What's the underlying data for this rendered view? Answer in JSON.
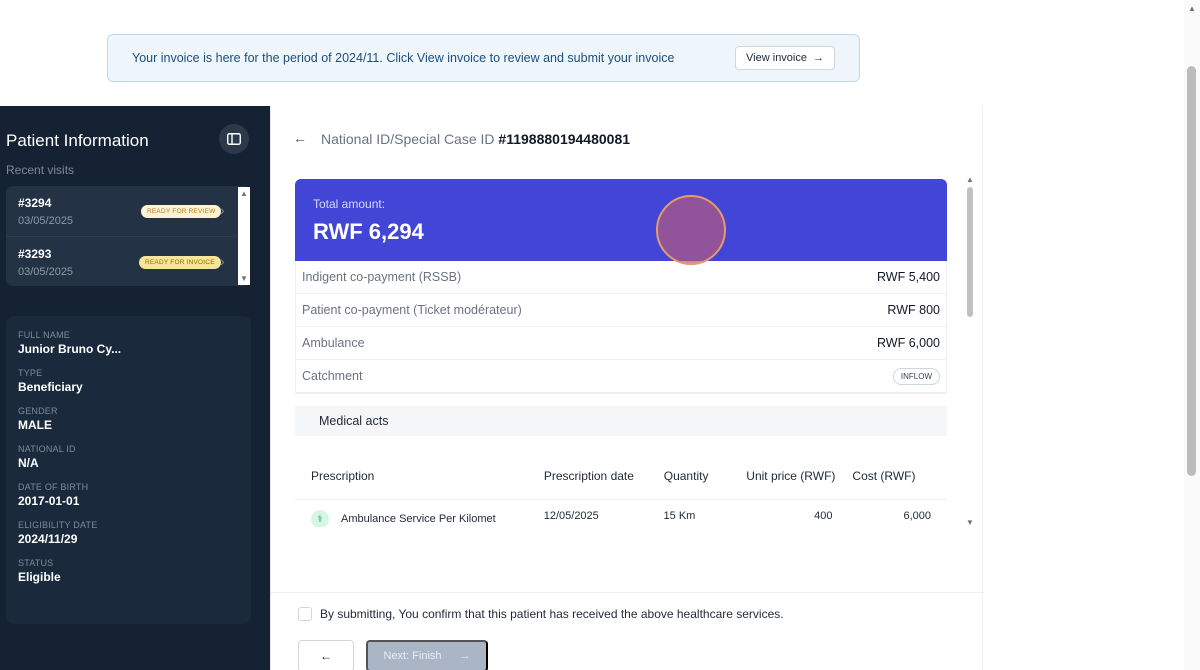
{
  "banner": {
    "message": "Your invoice is here for the period of 2024/11. Click View invoice to review and submit your invoice",
    "button_label": "View invoice",
    "button_icon": "→"
  },
  "sidebar": {
    "title": "Patient Information",
    "collapse_icon": "panel-icon",
    "recent_label": "Recent visits",
    "visits": [
      {
        "id": "#3294",
        "date": "03/05/2025",
        "badge": "READY FOR REVIEW"
      },
      {
        "id": "#3293",
        "date": "03/05/2025",
        "badge": "READY FOR INVOICE"
      }
    ],
    "info": [
      {
        "label": "FULL NAME",
        "value": "Junior Bruno Cy..."
      },
      {
        "label": "TYPE",
        "value": "Beneficiary"
      },
      {
        "label": "GENDER",
        "value": "MALE"
      },
      {
        "label": "NATIONAL ID",
        "value": "N/A"
      },
      {
        "label": "DATE OF BIRTH",
        "value": "2017-01-01"
      },
      {
        "label": "ELIGIBILITY DATE",
        "value": "2024/11/29"
      },
      {
        "label": "STATUS",
        "value": "Eligible"
      }
    ]
  },
  "main": {
    "back_icon": "←",
    "case_label": "National ID/Special Case ID",
    "case_id": "#1198880194480081",
    "total_label": "Total amount:",
    "total_amount": "RWF 6,294",
    "rows": [
      {
        "label": "Indigent co-payment (RSSB)",
        "value": "RWF 5,400"
      },
      {
        "label": "Patient co-payment (Ticket modérateur)",
        "value": "RWF 800"
      },
      {
        "label": "Ambulance",
        "value": "RWF 6,000"
      },
      {
        "label": "Catchment",
        "value": "INFLOW"
      }
    ],
    "medical_acts_label": "Medical acts",
    "table": {
      "headers": [
        "Prescription",
        "Prescription date",
        "Quantity",
        "Unit price (RWF)",
        "Cost (RWF)"
      ],
      "rows": [
        {
          "prescription": "Ambulance Service Per Kilomet",
          "date": "12/05/2025",
          "quantity": "15 Km",
          "unit_price": "400",
          "cost": "6,000"
        }
      ]
    },
    "confirm_text": "By submitting, You confirm that this patient has received the above healthcare services.",
    "back_button_icon": "←",
    "next_button_label": "Next: Finish",
    "next_button_icon": "→"
  }
}
